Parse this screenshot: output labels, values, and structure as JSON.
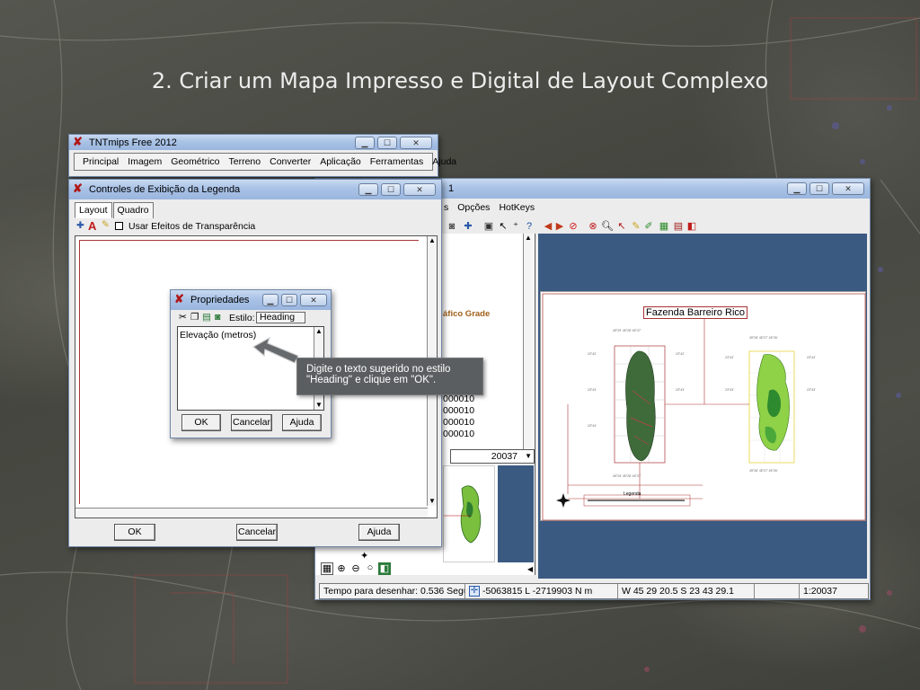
{
  "slide": {
    "title": "2. Criar um Mapa Impresso e Digital de Layout Complexo"
  },
  "tntmips": {
    "title": "TNTmips Free 2012",
    "menu": [
      "Principal",
      "Imagem",
      "Geométrico",
      "Terreno",
      "Converter",
      "Aplicação",
      "Ferramentas",
      "Ajuda"
    ]
  },
  "mapview": {
    "title_partial": "1",
    "menu": [
      "s",
      "Opções",
      "HotKeys"
    ],
    "layer_label": "áfico Grade",
    "list_values": [
      "000010",
      "000010",
      "000010",
      "000010",
      "00001"
    ],
    "scale_select": "20037",
    "map_title": "Fazenda Barreiro Rico",
    "legend_text": "Legenda",
    "status": {
      "draw_time": "Tempo para desenhar: 0.536 Segundos",
      "coords_ln": "-5063815 L -2719903 N m",
      "coords_ws": "W 45 29 20.5  S 23 43 29.1",
      "scale": "1:20037"
    }
  },
  "legend_controls": {
    "title": "Controles de Exibição da Legenda",
    "tabs": [
      "Layout",
      "Quadro"
    ],
    "transparency_label": "Usar Efeitos de Transparência",
    "ok": "OK",
    "cancel": "Cancelar",
    "help": "Ajuda"
  },
  "properties": {
    "title": "Propriedades",
    "style_label": "Estilo:",
    "style_value": "Heading",
    "text_value": "Elevação (metros)",
    "ok": "OK",
    "cancel": "Cancelar",
    "help": "Ajuda"
  },
  "callout": {
    "text": "Digite o texto sugerido no estilo \"Heading\" e clique em \"OK\"."
  },
  "colors": {
    "titlebar": "#a9c2e6",
    "map_bg": "#3a5a82",
    "callout_bg": "#5b5e60",
    "accent_red": "#b01818"
  }
}
